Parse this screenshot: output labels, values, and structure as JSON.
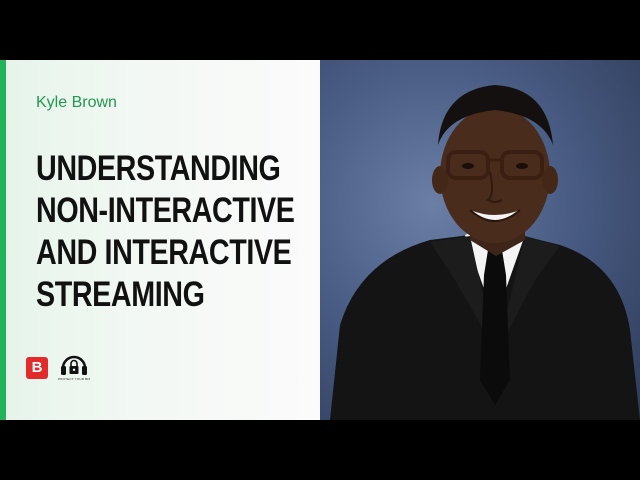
{
  "video": {
    "author": "Kyle Brown",
    "title_lines": [
      "UNDERSTANDING",
      "NON-INTERACTIVE",
      "AND INTERACTIVE",
      "STREAMING"
    ]
  },
  "logos": {
    "brand_letter": "B",
    "podcast_caption": "PROTECT YOUR BIZ"
  },
  "colors": {
    "accent": "#22b35a",
    "author_text": "#1f9a4d",
    "brand_red": "#e42b2b",
    "photo_background": "#4a5d85"
  },
  "icons": [
    "brand-logo-icon",
    "headphones-lock-icon"
  ]
}
